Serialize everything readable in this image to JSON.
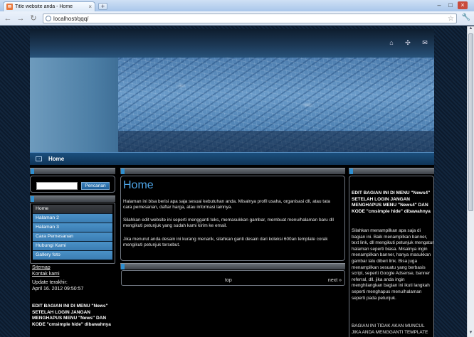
{
  "browser": {
    "tab_title": "Title website anda - Home",
    "tab_close": "×",
    "new_tab": "+",
    "url": "localhost/qqq/",
    "min": "–",
    "max": "□",
    "close": "×"
  },
  "site": {
    "menu_home": "Home",
    "search_placeholder": "",
    "search_button": "Pencarian",
    "nav": [
      "Home",
      "Halaman 2",
      "Halaman 3",
      "Cara Pemesanan",
      "Hubungi Kami",
      "Gallery foto"
    ],
    "links": [
      "Sitemap",
      "Kontak kami"
    ],
    "update_label": "Update terakhir:",
    "update_value": "April 16. 2012 09:50:57",
    "left_note": "EDIT BAGIAN INI DI MENU \"News\" SETELAH LOGIN JANGAN MENGHAPUS MENU \"News\" DAN KODE \"cmsimple hide\" dibawahnya",
    "main_title": "Home",
    "main_p1": "Halaman ini bisa berisi apa saja sesuai kebutuhan anda. Misalnya profil usaha, organisasi dll, atau tata cara pemesanan, daftar harga, atau informasi lainnya.",
    "main_p2": "Silahkan edit website ini seperti mengganti teks, memasukkan gambar, membuat menu/halaman baru dll mengikuti petunjuk yang sudah kami kirim ke email.",
    "main_p3": "Jika menurut anda desain ini kurang menarik, silahkan ganti desain dari koleksi 600an template corak mengikuti petunjuk tersebut.",
    "pager_top": "top",
    "pager_next": "next »",
    "right_title": "EDIT BAGIAN INI DI MENU \"News4\" SETELAH LOGIN JANGAN MENGHAPUS MENU \"News4\" DAN KODE \"cmsimple hide\" dibawahnya",
    "right_p1": "Silahkan menampilkan apa saja di bagian ini. Baik menampilkan banner, text link, dll mengikuti petunjuk mengatur halaman seperti biasa. Misalnya ingin menampilkan banner, hanya masukkan gambar lalu diberi link. Bisa juga menampilkan sesuatu yang berbasis script, seperti Google Adsense, banner referral, dll. jika anda ingin menghilangkan bagian ini ikuti langkah seperti menghapus menu/halaman seperti pada petunjuk.",
    "right_p2": "BAGIAN INI TIDAK AKAN MUNCUL JIKA ANDA MENGGANTI TEMPLATE"
  },
  "colors": {
    "accent_blue": "#4ea6e8",
    "nav_blue": "#3b7db3"
  }
}
